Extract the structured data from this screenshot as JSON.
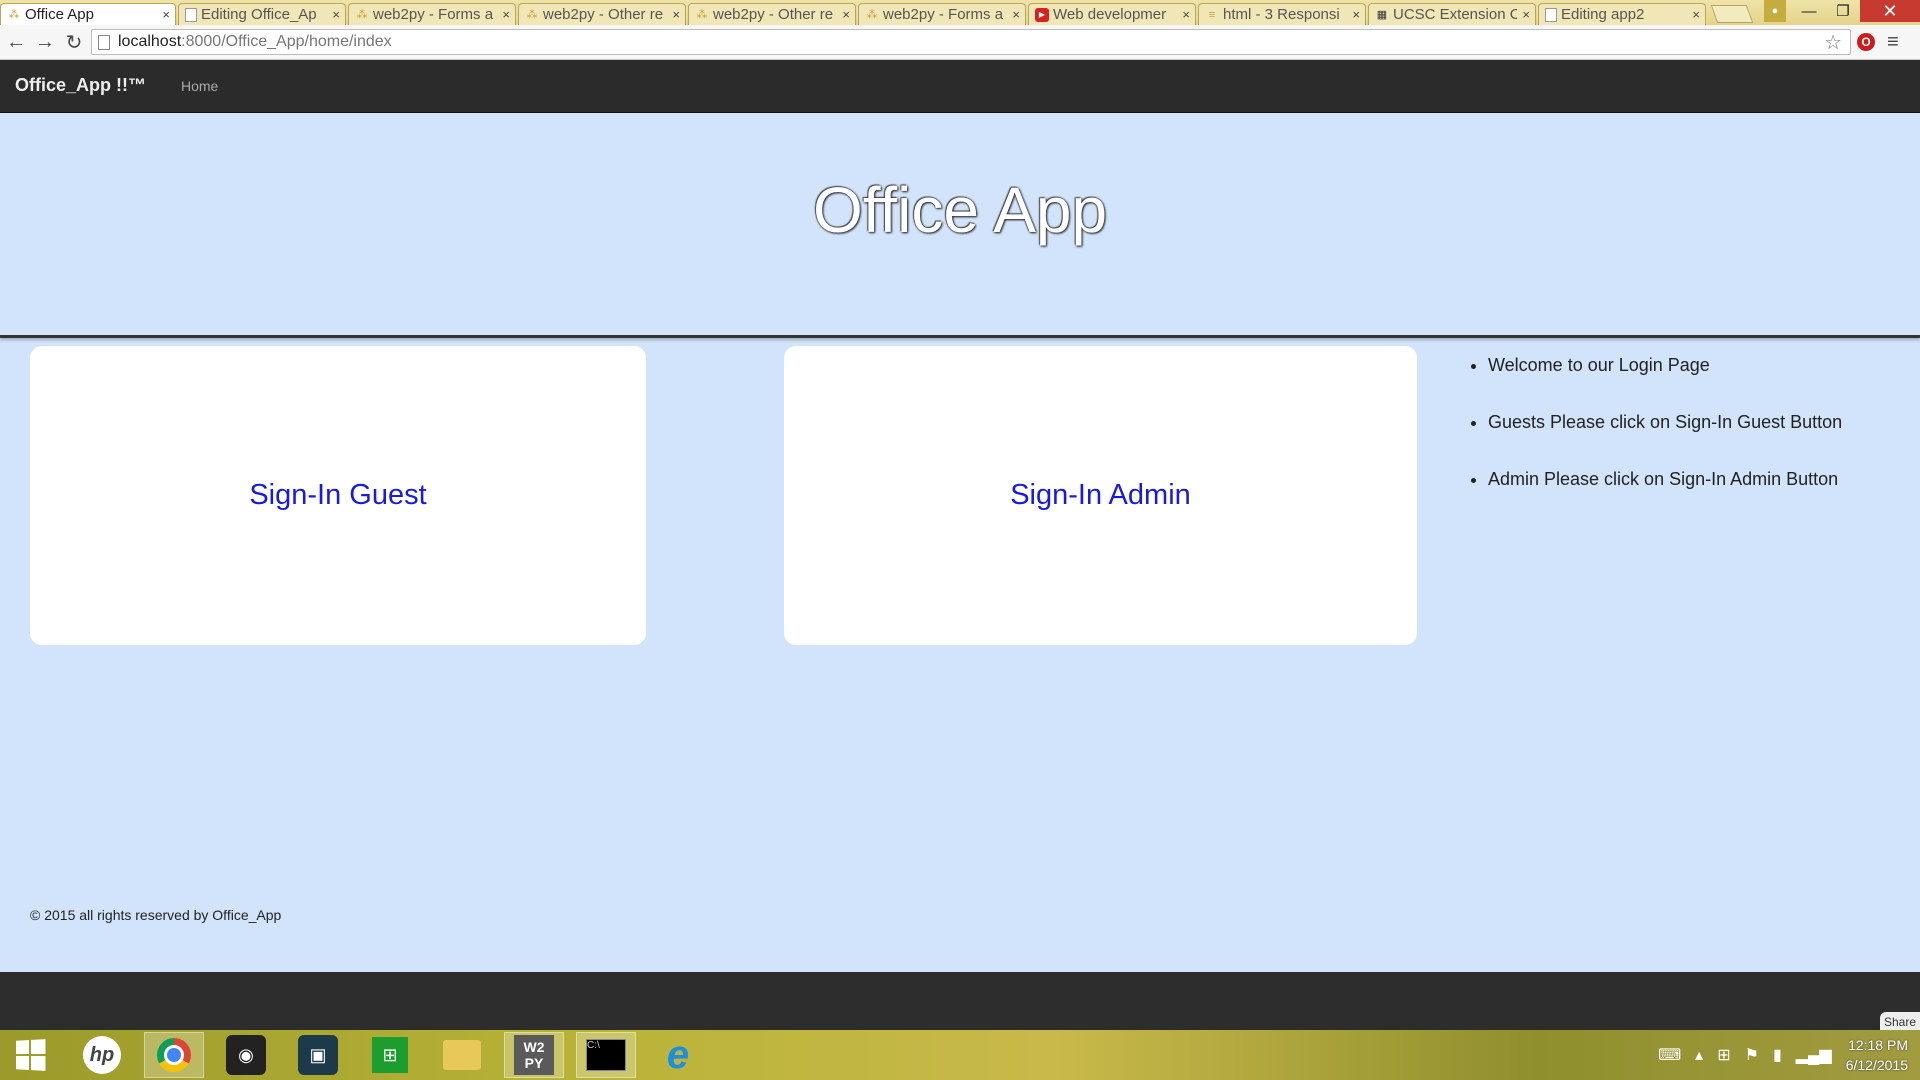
{
  "browser": {
    "tabs": [
      {
        "title": "Office App",
        "active": true,
        "icon": "web2py-icon"
      },
      {
        "title": "Editing Office_Ap",
        "active": false,
        "icon": "page-icon"
      },
      {
        "title": "web2py - Forms a",
        "active": false,
        "icon": "web2py-icon"
      },
      {
        "title": "web2py - Other re",
        "active": false,
        "icon": "web2py-icon"
      },
      {
        "title": "web2py - Other re",
        "active": false,
        "icon": "web2py-icon"
      },
      {
        "title": "web2py - Forms a",
        "active": false,
        "icon": "web2py-icon"
      },
      {
        "title": "Web developmer",
        "active": false,
        "icon": "youtube-icon"
      },
      {
        "title": "html - 3 Responsi",
        "active": false,
        "icon": "stackoverflow-icon"
      },
      {
        "title": "UCSC Extension C",
        "active": false,
        "icon": "ucsc-icon"
      },
      {
        "title": "Editing app2",
        "active": false,
        "icon": "page-icon"
      }
    ],
    "url_host": "localhost",
    "url_path": ":8000/Office_App/home/index"
  },
  "navbar": {
    "brand": "Office_App !!™",
    "links": [
      "Home"
    ]
  },
  "jumbotron": {
    "title": "Office App"
  },
  "cards": {
    "guest_label": "Sign-In Guest",
    "admin_label": "Sign-In Admin"
  },
  "info_list": [
    "Welcome to our Login Page",
    "Guests Please click on Sign-In Guest Button",
    "Admin Please click on Sign-In Admin Button"
  ],
  "footer": {
    "text": "© 2015 all rights reserved by Office_App"
  },
  "taskbar": {
    "time": "12:18 PM",
    "date": "6/12/2015",
    "share_label": "Share"
  },
  "colors": {
    "page_bg": "#d2e4fb",
    "navbar_bg": "#2b2b2b",
    "link_blue": "#1a1adf"
  }
}
